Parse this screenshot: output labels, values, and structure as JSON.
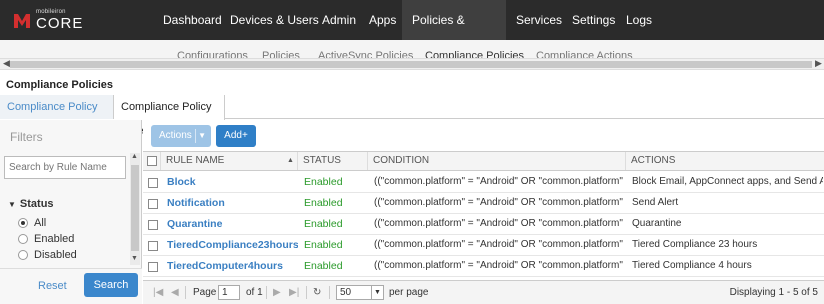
{
  "app": {
    "logo_small": "mobileiron",
    "logo_main": "CORE",
    "brand_color": "#d32f2f"
  },
  "nav": {
    "items": [
      "Dashboard",
      "Devices & Users",
      "Admin",
      "Apps",
      "Policies & Configs",
      "Services",
      "Settings",
      "Logs"
    ],
    "active": "Policies & Configs"
  },
  "subnav": {
    "items": [
      "Configurations",
      "Policies",
      "ActiveSync Policies",
      "Compliance Policies",
      "Compliance Actions"
    ],
    "active": "Compliance Policies"
  },
  "page": {
    "title": "Compliance Policies"
  },
  "tabs": [
    "Compliance Policy Group",
    "Compliance Policy Rule"
  ],
  "filters": {
    "title": "Filters",
    "search_placeholder": "Search by Rule Name",
    "status_label": "Status",
    "status_options": [
      "All",
      "Enabled",
      "Disabled"
    ],
    "status_selected": "All",
    "reset_label": "Reset",
    "search_label": "Search"
  },
  "toolbar": {
    "actions_label": "Actions",
    "add_label": "Add+"
  },
  "table": {
    "columns": [
      "RULE NAME",
      "STATUS",
      "CONDITION",
      "ACTIONS"
    ],
    "rows": [
      {
        "name": "Block",
        "status": "Enabled",
        "condition": "((\"common.platform\" = \"Android\" OR \"common.platform\" = \"iO...",
        "actions": "Block Email, AppConnect apps, and Send Alert"
      },
      {
        "name": "Notification",
        "status": "Enabled",
        "condition": "((\"common.platform\" = \"Android\" OR \"common.platform\" = \"iO...",
        "actions": "Send Alert"
      },
      {
        "name": "Quarantine",
        "status": "Enabled",
        "condition": "((\"common.platform\" = \"Android\" OR \"common.platform\" = \"iO...",
        "actions": "Quarantine"
      },
      {
        "name": "TieredCompliance23hours",
        "status": "Enabled",
        "condition": "((\"common.platform\" = \"Android\" OR \"common.platform\" = \"iO...",
        "actions": "Tiered Compliance 23 hours"
      },
      {
        "name": "TieredComputer4hours",
        "status": "Enabled",
        "condition": "((\"common.platform\" = \"Android\" OR \"common.platform\" = \"iO...",
        "actions": "Tiered Compliance 4 hours"
      }
    ]
  },
  "pager": {
    "page_label": "Page",
    "page_value": "1",
    "of_label": "of 1",
    "page_size": "50",
    "per_page_label": "per page",
    "displaying": "Displaying 1 - 5 of 5"
  }
}
